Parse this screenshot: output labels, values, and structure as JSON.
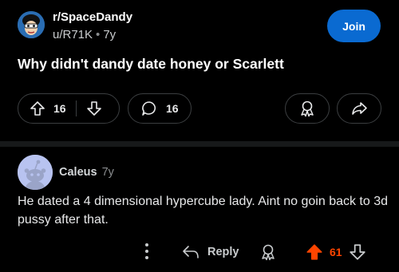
{
  "post": {
    "subreddit": "r/SpaceDandy",
    "author": "u/R71K",
    "age": "7y",
    "join_label": "Join",
    "title": "Why didn't dandy date honey or Scarlett",
    "votes": "16",
    "comments": "16"
  },
  "comment": {
    "author": "Caleus",
    "age": "7y",
    "body": "He dated a 4 dimensional hypercube lady. Aint no goin back to 3d pussy after that.",
    "reply_label": "Reply",
    "votes": "61"
  },
  "icons": {
    "upvote": "upvote-arrow-icon",
    "downvote": "downvote-arrow-icon",
    "comment": "speech-bubble-icon",
    "award": "award-ribbon-icon",
    "share": "share-arrow-icon",
    "reply": "reply-arrow-icon",
    "more": "vertical-dots-icon"
  },
  "colors": {
    "background": "#000000",
    "join_button": "#0a6ad1",
    "upvoted": "#ff4500",
    "pill_border": "#3b3e40"
  }
}
